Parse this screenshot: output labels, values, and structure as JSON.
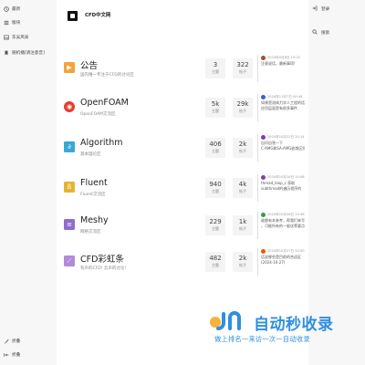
{
  "sidebar": {
    "items": [
      {
        "label": "最新",
        "icon": "clock-icon"
      },
      {
        "label": "版块",
        "icon": "list-icon"
      },
      {
        "label": "东吴风采",
        "icon": "image-icon"
      },
      {
        "label": "随机播[请注意音]",
        "icon": "bookmark-icon"
      }
    ],
    "bottom_items": [
      {
        "label": "折叠",
        "icon": "brush-icon"
      },
      {
        "label": "折叠",
        "icon": "collapse-icon"
      }
    ]
  },
  "right_nav": {
    "login": "登录",
    "search": "搜索"
  },
  "header": {
    "site_name": "CFD中文网"
  },
  "stat_labels": {
    "topics": "主题",
    "posts": "帖子"
  },
  "categories": [
    {
      "title": "公告",
      "description": "国内唯一专注于CFD的讨论区",
      "icon": "megaphone-icon",
      "icon_color": "#f3a43b",
      "icon_glyph": "▶",
      "topics": "3",
      "posts": "322",
      "latest": {
        "time": "2024年5月8日 15:02",
        "lines": [
          "注意说话，最新事项!"
        ],
        "avatar_color": "#a0522d"
      }
    },
    {
      "title": "OpenFOAM",
      "description": "OpenFOAM交流区",
      "icon": "openfoam-icon",
      "icon_color": "#e53d2f",
      "icon_glyph": "◉",
      "topics": "5k",
      "posts": "29k",
      "latest": {
        "time": "2024年11月7日 00:44",
        "lines": [
          "如果是流体力学人工程的话",
          "应用层面是有很多事件"
        ],
        "avatar_color": "#3b5bdb"
      }
    },
    {
      "title": "Algorithm",
      "description": "基本理论区",
      "icon": "formula-icon",
      "icon_color": "#36a9d6",
      "icon_glyph": "∂",
      "topics": "406",
      "posts": "2k",
      "latest": {
        "time": "2024年10月22日 20:14",
        "lines": [
          "自问自答一下",
          "C-AMG和SA-AMG收敛区别"
        ],
        "avatar_color": "#7b3fb3"
      }
    },
    {
      "title": "Fluent",
      "description": "Fluent交流区",
      "icon": "fluent-icon",
      "icon_color": "#e6b435",
      "icon_glyph": "ß",
      "topics": "940",
      "posts": "4k",
      "latest": {
        "time": "2024年10月18日 10:58",
        "lines": [
          "thread_loop_c 获取",
          "subthread的遍历程序的"
        ],
        "avatar_color": "#7b3fb3"
      }
    },
    {
      "title": "Meshy",
      "description": "网格交流区",
      "icon": "mesh-icon",
      "icon_color": "#8f6dcf",
      "icon_glyph": "≡",
      "topics": "229",
      "posts": "1k",
      "latest": {
        "time": "2024年10月28日 13:46",
        "lines": [
          "谁都有本参考，帮我们来写",
          "，可能所有的一般化等要点"
        ],
        "avatar_color": "#2f9e44"
      }
    },
    {
      "title": "CFD彩虹条",
      "description": "有声的CFD! 云声的讨论!",
      "icon": "chart-icon",
      "icon_color": "#b18ad9",
      "icon_glyph": "⟋",
      "topics": "482",
      "posts": "2k",
      "latest": {
        "time": "2024年10月27日 20:00",
        "lines": [
          "话说哪些是目前的合适区",
          "(2024-10-27)"
        ],
        "avatar_color": "#e8590c"
      }
    }
  ],
  "watermark": {
    "big": "自动秒收录",
    "small": "做上排名一来访一次一自动收录"
  }
}
